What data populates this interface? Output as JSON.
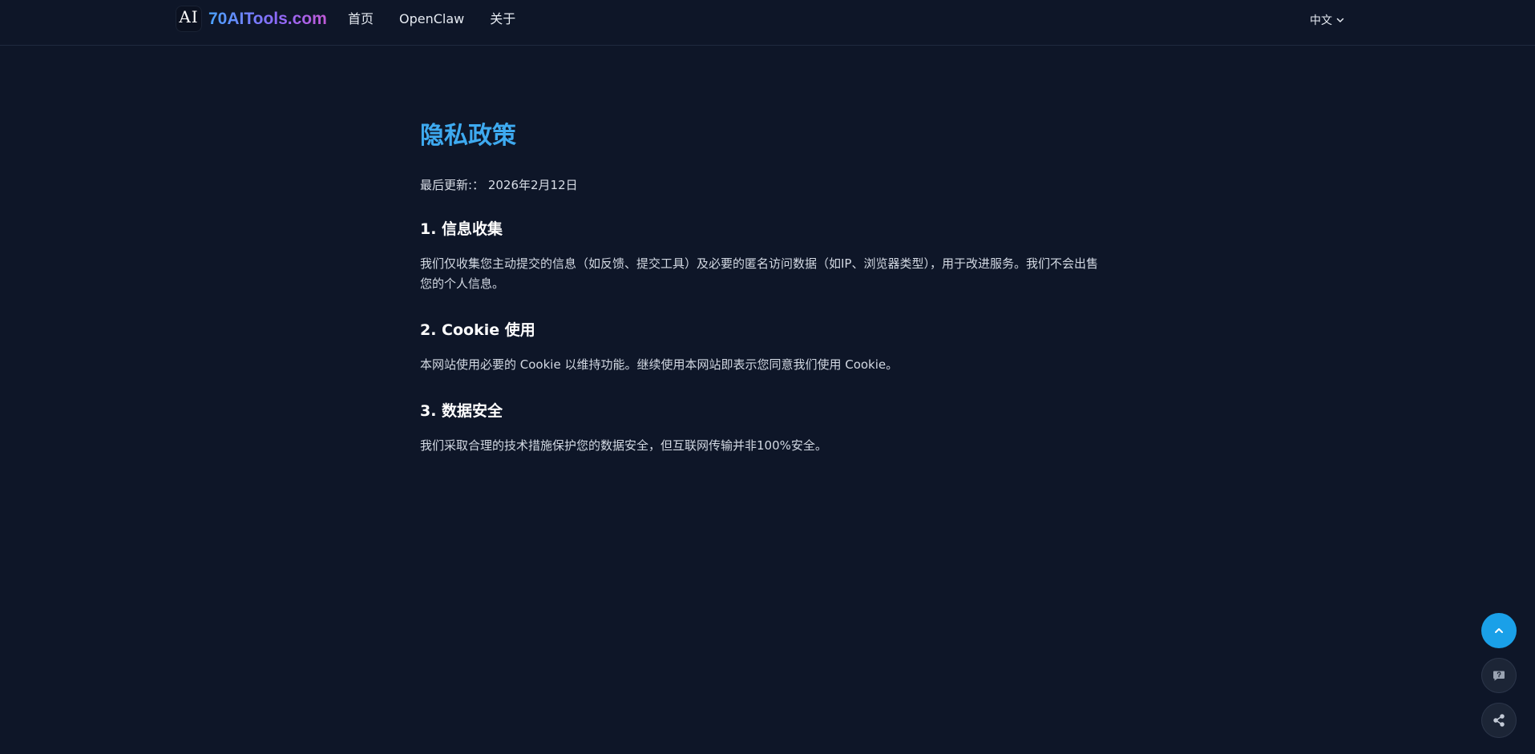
{
  "header": {
    "logo_mark": "AI",
    "logo_text": "70AITools.com",
    "nav": [
      {
        "label": "首页"
      },
      {
        "label": "OpenClaw"
      },
      {
        "label": "关于"
      }
    ],
    "language": "中文"
  },
  "page": {
    "title": "隐私政策",
    "updated": "最后更新:： 2026年2月12日",
    "sections": [
      {
        "title": "1. 信息收集",
        "body": "我们仅收集您主动提交的信息（如反馈、提交工具）及必要的匿名访问数据（如IP、浏览器类型），用于改进服务。我们不会出售您的个人信息。"
      },
      {
        "title": "2. Cookie 使用",
        "body": "本网站使用必要的 Cookie 以维持功能。继续使用本网站即表示您同意我们使用 Cookie。"
      },
      {
        "title": "3. 数据安全",
        "body": "我们采取合理的技术措施保护您的数据安全，但互联网传输并非100%安全。"
      }
    ]
  },
  "fabs": {
    "top_icon": "chevron-up-icon",
    "feedback_icon": "feedback-icon",
    "share_icon": "share-icon"
  },
  "colors": {
    "background": "#0e1628",
    "title": "#3eaaf0",
    "accent": "#1aa0e8"
  }
}
